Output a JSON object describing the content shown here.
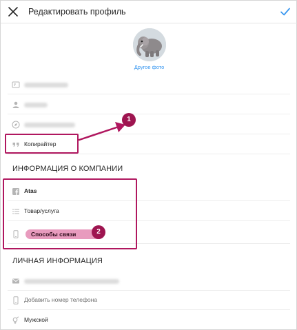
{
  "header": {
    "title": "Редактировать профиль"
  },
  "profile": {
    "change_photo_label": "Другое фото"
  },
  "fields": {
    "bio": "Копирайтер"
  },
  "company": {
    "section_title": "ИНФОРМАЦИЯ О КОМПАНИИ",
    "page_name": "Atas",
    "category": "Товар/услуга",
    "contact_options": "Способы связи"
  },
  "personal": {
    "section_title": "ЛИЧНАЯ ИНФОРМАЦИЯ",
    "add_phone": "Добавить номер телефона",
    "gender": "Мужской"
  },
  "annotations": {
    "badge_1": "1",
    "badge_2": "2"
  },
  "colors": {
    "accent": "#3897f0",
    "annotation": "#b0175f",
    "highlight": "#e48ab3"
  }
}
